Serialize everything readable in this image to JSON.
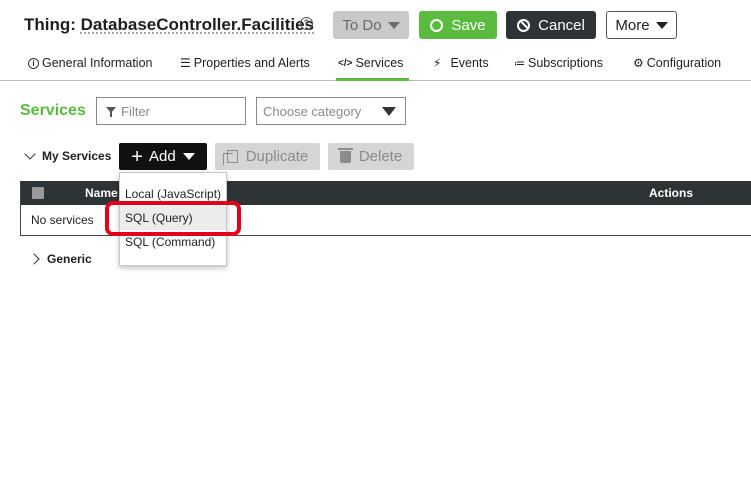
{
  "header": {
    "title_prefix": "Thing: ",
    "title_name": "DatabaseController.Facilities",
    "help_icon": "question-circle-icon",
    "todo_label": "To Do",
    "save_label": "Save",
    "cancel_label": "Cancel",
    "more_label": "More"
  },
  "tabs": [
    {
      "label": "General Information",
      "icon": "info-circle-icon"
    },
    {
      "label": "Properties and Alerts",
      "icon": "list-icon"
    },
    {
      "label": "Services",
      "icon": "code-icon",
      "active": true
    },
    {
      "label": "Events",
      "icon": "lightning-icon"
    },
    {
      "label": "Subscriptions",
      "icon": "rss-icon"
    },
    {
      "label": "Configuration",
      "icon": "gear-icon"
    }
  ],
  "services": {
    "title": "Services",
    "filter_placeholder": "Filter",
    "category_placeholder": "Choose category",
    "my_services_label": "My Services",
    "add_label": "Add",
    "duplicate_label": "Duplicate",
    "delete_label": "Delete",
    "generic_label": "Generic"
  },
  "table": {
    "columns": [
      "Name",
      "Actions"
    ],
    "empty_text": "No services"
  },
  "add_menu": {
    "items": [
      "Local (JavaScript)",
      "SQL (Query)",
      "SQL (Command)"
    ],
    "hovered_index": 1
  },
  "colors": {
    "accent_green": "#5bbb3f",
    "dark": "#2e3436",
    "highlight_red": "#e3001b"
  }
}
